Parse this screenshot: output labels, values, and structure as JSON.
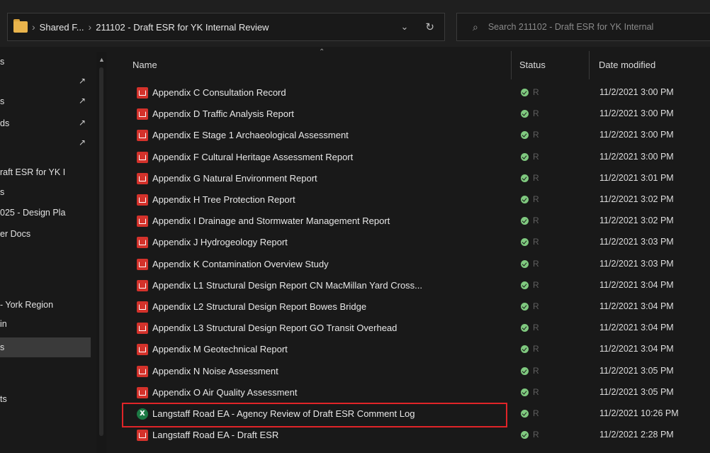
{
  "address_bar": {
    "crumbs": [
      "Shared F...",
      "211102 - Draft ESR for YK Internal Review"
    ],
    "separator": "›",
    "chevron": "⌄",
    "refresh": "↻"
  },
  "search": {
    "placeholder": "Search 211102 - Draft ESR for YK Internal"
  },
  "nav": {
    "items": [
      {
        "label": "s",
        "pinned": false
      },
      {
        "label": "",
        "pinned": true
      },
      {
        "label": "s",
        "pinned": true
      },
      {
        "label": "ds",
        "pinned": true
      },
      {
        "label": "",
        "pinned": true
      },
      {
        "label": "raft ESR for YK I",
        "pinned": false
      },
      {
        "label": "s",
        "pinned": false
      },
      {
        "label": "025 - Design Pla",
        "pinned": false
      },
      {
        "label": "er Docs",
        "pinned": false
      },
      {
        "label": "",
        "pinned": false
      },
      {
        "label": "",
        "pinned": false
      },
      {
        "label": "- York Region",
        "pinned": false
      },
      {
        "label": "in",
        "pinned": false
      },
      {
        "label": "s",
        "pinned": false
      },
      {
        "label": "",
        "pinned": false
      },
      {
        "label": "ts",
        "pinned": false
      }
    ]
  },
  "columns": {
    "name": "Name",
    "status": "Status",
    "date_modified": "Date modified"
  },
  "files": [
    {
      "name": "Appendix C Consultation Record",
      "type": "pdf",
      "status": "R",
      "date": "11/2/2021 3:00 PM"
    },
    {
      "name": "Appendix D Traffic Analysis Report",
      "type": "pdf",
      "status": "R",
      "date": "11/2/2021 3:00 PM"
    },
    {
      "name": "Appendix E Stage 1 Archaeological Assessment",
      "type": "pdf",
      "status": "R",
      "date": "11/2/2021 3:00 PM"
    },
    {
      "name": "Appendix F Cultural Heritage Assessment Report",
      "type": "pdf",
      "status": "R",
      "date": "11/2/2021 3:00 PM"
    },
    {
      "name": "Appendix G Natural Environment Report",
      "type": "pdf",
      "status": "R",
      "date": "11/2/2021 3:01 PM"
    },
    {
      "name": "Appendix H Tree Protection Report",
      "type": "pdf",
      "status": "R",
      "date": "11/2/2021 3:02 PM"
    },
    {
      "name": "Appendix I Drainage and Stormwater Management Report",
      "type": "pdf",
      "status": "R",
      "date": "11/2/2021 3:02 PM"
    },
    {
      "name": "Appendix J Hydrogeology Report",
      "type": "pdf",
      "status": "R",
      "date": "11/2/2021 3:03 PM"
    },
    {
      "name": "Appendix K Contamination Overview Study",
      "type": "pdf",
      "status": "R",
      "date": "11/2/2021 3:03 PM"
    },
    {
      "name": "Appendix L1 Structural Design Report CN MacMillan Yard Cross...",
      "type": "pdf",
      "status": "R",
      "date": "11/2/2021 3:04 PM"
    },
    {
      "name": "Appendix L2 Structural Design Report Bowes Bridge",
      "type": "pdf",
      "status": "R",
      "date": "11/2/2021 3:04 PM"
    },
    {
      "name": "Appendix L3 Structural Design Report GO Transit Overhead",
      "type": "pdf",
      "status": "R",
      "date": "11/2/2021 3:04 PM"
    },
    {
      "name": "Appendix M Geotechnical Report",
      "type": "pdf",
      "status": "R",
      "date": "11/2/2021 3:04 PM"
    },
    {
      "name": "Appendix N Noise Assessment",
      "type": "pdf",
      "status": "R",
      "date": "11/2/2021 3:05 PM"
    },
    {
      "name": "Appendix O Air Quality Assessment",
      "type": "pdf",
      "status": "R",
      "date": "11/2/2021 3:05 PM"
    },
    {
      "name": "Langstaff Road EA - Agency Review of Draft ESR Comment Log",
      "type": "xlsx",
      "status": "R",
      "date": "11/2/2021 10:26 PM",
      "highlighted": true
    },
    {
      "name": "Langstaff Road EA - Draft ESR",
      "type": "pdf",
      "status": "R",
      "date": "11/2/2021 2:28 PM"
    }
  ],
  "colors": {
    "background": "#191919",
    "highlight_border": "#e02428",
    "status_ok": "#7fc97f",
    "pdf_red": "#d4322b",
    "excel_green": "#1d7a45"
  }
}
